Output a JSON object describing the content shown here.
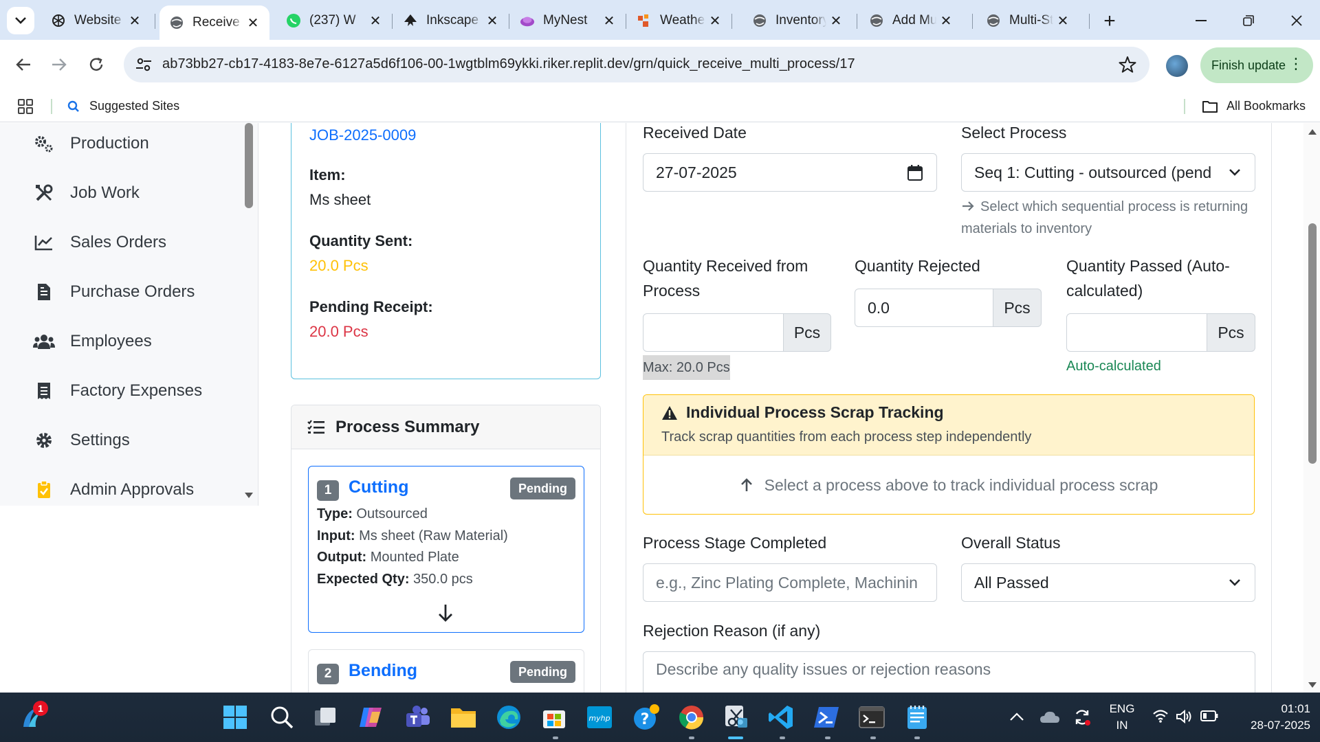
{
  "browser": {
    "tabs": [
      {
        "title": "Website",
        "icon": "openai-icon"
      },
      {
        "title": "Receive",
        "icon": "globe-icon",
        "active": true
      },
      {
        "title": "(237) W",
        "icon": "whatsapp-icon"
      },
      {
        "title": "Inkscape",
        "icon": "inkscape-icon"
      },
      {
        "title": "MyNest",
        "icon": "mynest-icon"
      },
      {
        "title": "Weather",
        "icon": "weather-icon"
      },
      {
        "title": "Inventory",
        "icon": "globe-icon"
      },
      {
        "title": "Add Mu",
        "icon": "globe-icon"
      },
      {
        "title": "Multi-St",
        "icon": "globe-icon"
      }
    ],
    "url": "ab73bb27-cb17-4183-8e7e-6127a5d6f106-00-1wgtblm69ykki.riker.replit.dev/grn/quick_receive_multi_process/17",
    "finish_update": "Finish update",
    "bookmarks": {
      "suggested": "Suggested Sites",
      "all": "All Bookmarks"
    }
  },
  "sidebar": {
    "items": [
      {
        "label": "Production",
        "icon": "cogs-icon"
      },
      {
        "label": "Job Work",
        "icon": "tools-icon"
      },
      {
        "label": "Sales Orders",
        "icon": "chart-line-icon"
      },
      {
        "label": "Purchase Orders",
        "icon": "file-invoice-icon"
      },
      {
        "label": "Employees",
        "icon": "users-icon"
      },
      {
        "label": "Factory Expenses",
        "icon": "receipt-icon"
      },
      {
        "label": "Settings",
        "icon": "gear-icon"
      },
      {
        "label": "Admin Approvals",
        "icon": "clipboard-check-icon"
      }
    ]
  },
  "job_card": {
    "job_number": "JOB-2025-0009",
    "item_label": "Item:",
    "item_value": "Ms sheet",
    "qty_sent_label": "Quantity Sent:",
    "qty_sent_value": "20.0 Pcs",
    "pending_label": "Pending Receipt:",
    "pending_value": "20.0 Pcs",
    "colors": {
      "sent": "#ffc107",
      "pending": "#dc3545"
    }
  },
  "process_summary": {
    "title": "Process Summary",
    "steps": [
      {
        "num": "1",
        "name": "Cutting",
        "status": "Pending",
        "type_label": "Type:",
        "type": "Outsourced",
        "input_label": "Input:",
        "input": "Ms sheet (Raw Material)",
        "output_label": "Output:",
        "output": "Mounted Plate",
        "expected_label": "Expected Qty:",
        "expected": "350.0 pcs"
      },
      {
        "num": "2",
        "name": "Bending",
        "status": "Pending"
      }
    ]
  },
  "form": {
    "received_date_label": "Received Date",
    "received_date": "27-07-2025",
    "select_process_label": "Select Process",
    "select_process_value": "Seq 1: Cutting - outsourced (pend",
    "select_process_hint": "Select which sequential process is returning materials to inventory",
    "qty_received_label": "Quantity Received from Process",
    "qty_received_value": "",
    "qty_received_unit": "Pcs",
    "qty_received_hint": "Max: 20.0 Pcs",
    "qty_rejected_label": "Quantity Rejected",
    "qty_rejected_value": "0.0",
    "qty_rejected_unit": "Pcs",
    "qty_passed_label": "Quantity Passed (Auto-calculated)",
    "qty_passed_value": "",
    "qty_passed_unit": "Pcs",
    "qty_passed_hint": "Auto-calculated",
    "scrap_title": "Individual Process Scrap Tracking",
    "scrap_subtitle": "Track scrap quantities from each process step independently",
    "scrap_prompt": "Select a process above to track individual process scrap",
    "stage_label": "Process Stage Completed",
    "stage_placeholder": "e.g., Zinc Plating Complete, Machinin",
    "overall_status_label": "Overall Status",
    "overall_status_value": "All Passed",
    "rejection_label": "Rejection Reason (if any)",
    "rejection_placeholder": "Describe any quality issues or rejection reasons"
  },
  "taskbar": {
    "notification_count": "1",
    "lang_top": "ENG",
    "lang_bottom": "IN",
    "time": "01:01",
    "date": "28-07-2025"
  }
}
